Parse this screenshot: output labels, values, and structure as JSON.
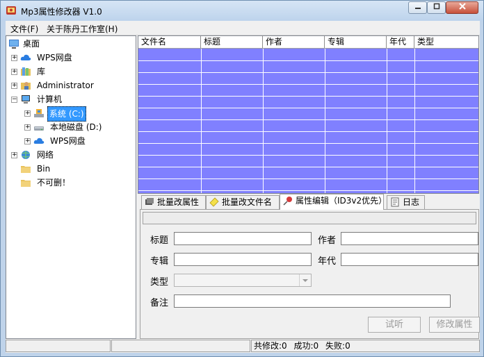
{
  "window": {
    "title": "Mp3属性修改器 V1.0"
  },
  "menu": {
    "items": [
      "文件(F)",
      "关于陈丹工作室(H)"
    ]
  },
  "tree": {
    "items": [
      {
        "label": "桌面",
        "icon": "desktop-icon"
      },
      {
        "label": "WPS网盘",
        "icon": "cloud-icon"
      },
      {
        "label": "库",
        "icon": "library-icon"
      },
      {
        "label": "Administrator",
        "icon": "user-folder-icon"
      },
      {
        "label": "计算机",
        "icon": "computer-icon"
      },
      {
        "label": "系统 (C:)",
        "icon": "system-drive-icon",
        "selected": true
      },
      {
        "label": "本地磁盘 (D:)",
        "icon": "drive-icon"
      },
      {
        "label": "WPS网盘",
        "icon": "cloud-icon"
      },
      {
        "label": "网络",
        "icon": "network-icon"
      },
      {
        "label": "Bin",
        "icon": "folder-icon"
      },
      {
        "label": "不可删！",
        "icon": "folder-icon"
      }
    ]
  },
  "grid": {
    "columns": [
      "文件名",
      "标题",
      "作者",
      "专辑",
      "年代",
      "类型"
    ],
    "row_color": "#8080ff"
  },
  "tabs": {
    "items": [
      {
        "label": "批量改属性",
        "icon": "batch-edit-icon"
      },
      {
        "label": "批量改文件名",
        "icon": "rename-icon"
      },
      {
        "label": "属性编辑（ID3v2优先）",
        "icon": "pin-icon",
        "active": true
      },
      {
        "label": "日志",
        "icon": "log-icon"
      }
    ]
  },
  "form": {
    "title_label": "标题",
    "author_label": "作者",
    "album_label": "专辑",
    "year_label": "年代",
    "genre_label": "类型",
    "note_label": "备注",
    "title_value": "",
    "author_value": "",
    "album_value": "",
    "year_value": "",
    "genre_value": "",
    "note_value": ""
  },
  "buttons": {
    "preview": "试听",
    "modify": "修改属性"
  },
  "status": {
    "modified": "共修改:0",
    "success": "成功:0",
    "failed": "失败:0"
  }
}
